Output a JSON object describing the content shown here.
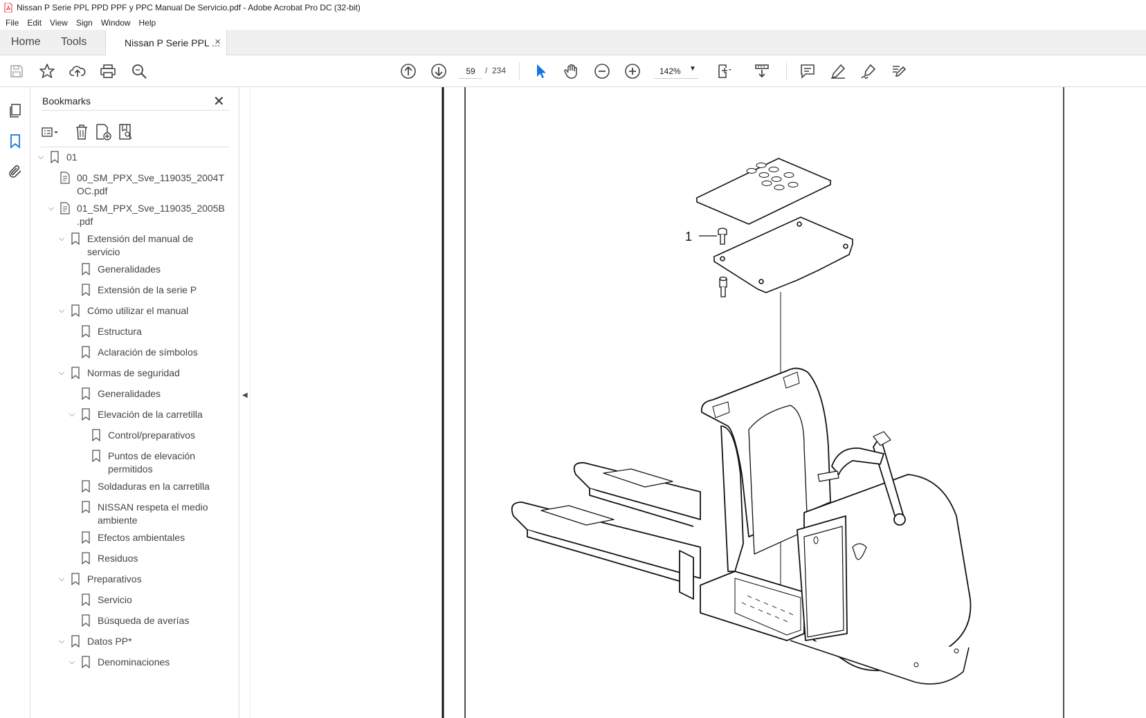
{
  "window": {
    "title": "Nissan P Serie PPL PPD PPF y PPC Manual De Servicio.pdf - Adobe Acrobat Pro DC (32-bit)"
  },
  "menu": [
    "File",
    "Edit",
    "View",
    "Sign",
    "Window",
    "Help"
  ],
  "tabs": {
    "home": "Home",
    "tools": "Tools",
    "document": "Nissan P Serie PPL ...",
    "close": "×"
  },
  "toolbar": {
    "current_page": "59",
    "page_separator": "/",
    "total_pages": "234",
    "zoom": "142%",
    "icons": [
      "save-icon",
      "star-icon",
      "upload-icon",
      "print-icon",
      "zoom-search-icon",
      "prev-page-icon",
      "next-page-icon",
      "select-pointer-icon",
      "hand-icon",
      "zoom-out-icon",
      "zoom-in-icon",
      "page-fit-icon",
      "scroll-mode-icon",
      "comment-icon",
      "highlight-icon",
      "sign-icon",
      "edit-icon"
    ]
  },
  "bookmarks": {
    "title": "Bookmarks",
    "close": "✕",
    "items": [
      {
        "label": "01",
        "level": 0,
        "expanded": true,
        "type": "bookmark"
      },
      {
        "label": "00_SM_PPX_Sve_119035_2004T\nOC.pdf",
        "level": 1,
        "expanded": null,
        "type": "file"
      },
      {
        "label": "01_SM_PPX_Sve_119035_2005B\n.pdf",
        "level": 1,
        "expanded": true,
        "type": "file"
      },
      {
        "label": "Extensión del manual de\nservicio",
        "level": 2,
        "expanded": true,
        "type": "bookmark"
      },
      {
        "label": "Generalidades",
        "level": 3,
        "expanded": null,
        "type": "bookmark"
      },
      {
        "label": "Extensión de la serie P",
        "level": 3,
        "expanded": null,
        "type": "bookmark"
      },
      {
        "label": "Cómo utilizar el manual",
        "level": 2,
        "expanded": true,
        "type": "bookmark"
      },
      {
        "label": "Estructura",
        "level": 3,
        "expanded": null,
        "type": "bookmark"
      },
      {
        "label": "Aclaración de símbolos",
        "level": 3,
        "expanded": null,
        "type": "bookmark"
      },
      {
        "label": "Normas de seguridad",
        "level": 2,
        "expanded": true,
        "type": "bookmark"
      },
      {
        "label": "Generalidades",
        "level": 3,
        "expanded": null,
        "type": "bookmark"
      },
      {
        "label": "Elevación de la carretilla",
        "level": 3,
        "expanded": true,
        "type": "bookmark"
      },
      {
        "label": "Control/preparativos",
        "level": 4,
        "expanded": null,
        "type": "bookmark"
      },
      {
        "label": "Puntos de elevación\npermitidos",
        "level": 4,
        "expanded": null,
        "type": "bookmark"
      },
      {
        "label": "Soldaduras en la carretilla",
        "level": 3,
        "expanded": null,
        "type": "bookmark"
      },
      {
        "label": "NISSAN respeta el medio\nambiente",
        "level": 3,
        "expanded": null,
        "type": "bookmark"
      },
      {
        "label": "Efectos ambientales",
        "level": 3,
        "expanded": null,
        "type": "bookmark"
      },
      {
        "label": "Residuos",
        "level": 3,
        "expanded": null,
        "type": "bookmark"
      },
      {
        "label": "Preparativos",
        "level": 2,
        "expanded": true,
        "type": "bookmark"
      },
      {
        "label": "Servicio",
        "level": 3,
        "expanded": null,
        "type": "bookmark"
      },
      {
        "label": "Búsqueda de averías",
        "level": 3,
        "expanded": null,
        "type": "bookmark"
      },
      {
        "label": "Datos PP*",
        "level": 2,
        "expanded": true,
        "type": "bookmark"
      },
      {
        "label": "Denominaciones",
        "level": 3,
        "expanded": true,
        "type": "bookmark"
      }
    ]
  },
  "document": {
    "callout_label": "1"
  }
}
